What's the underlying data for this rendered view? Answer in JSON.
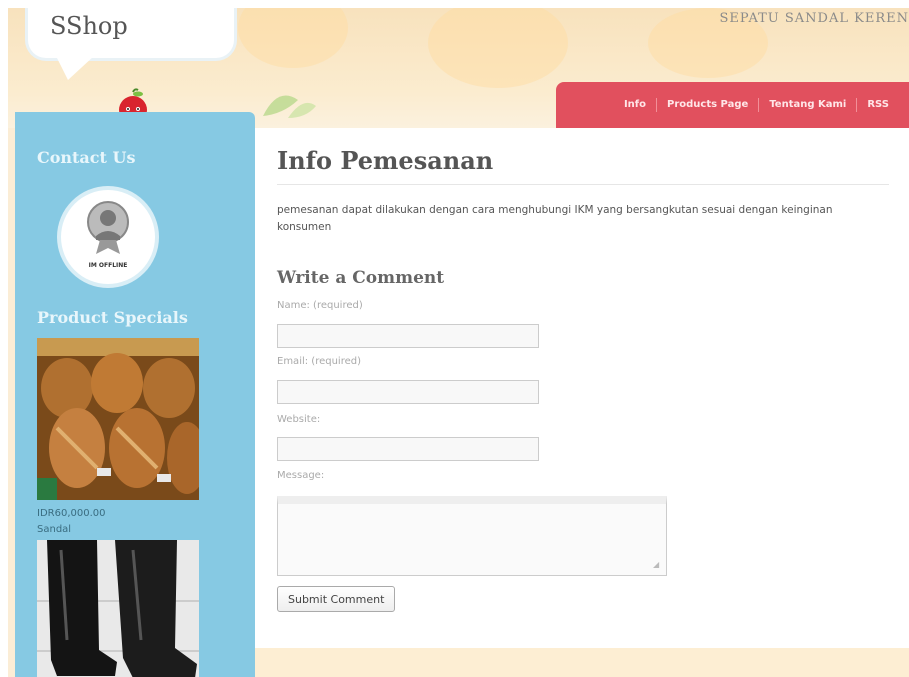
{
  "header": {
    "logo": "SShop",
    "tagline": "SEPATU SANDAL KEREN"
  },
  "nav": {
    "items": [
      "Info",
      "Products Page",
      "Tentang Kami",
      "RSS"
    ]
  },
  "sidebar": {
    "contact_heading": "Contact Us",
    "badge_text": "IM OFFLINE",
    "specials_heading": "Product Specials",
    "product": {
      "price": "IDR60,000.00",
      "name": "Sandal"
    }
  },
  "main": {
    "title": "Info Pemesanan",
    "body": "pemesanan dapat dilakukan dengan cara menghubungi IKM yang bersangkutan sesuai dengan keinginan konsumen",
    "comment_heading": "Write a Comment",
    "labels": {
      "name": "Name: (required)",
      "email": "Email: (required)",
      "website": "Website:",
      "message": "Message:"
    },
    "values": {
      "name": "",
      "email": "",
      "website": "",
      "message": ""
    },
    "submit_label": "Submit Comment"
  },
  "colors": {
    "nav_bg": "#e1505e",
    "sidebar_bg": "#86c9e3",
    "page_bg": "#fbedd6"
  }
}
